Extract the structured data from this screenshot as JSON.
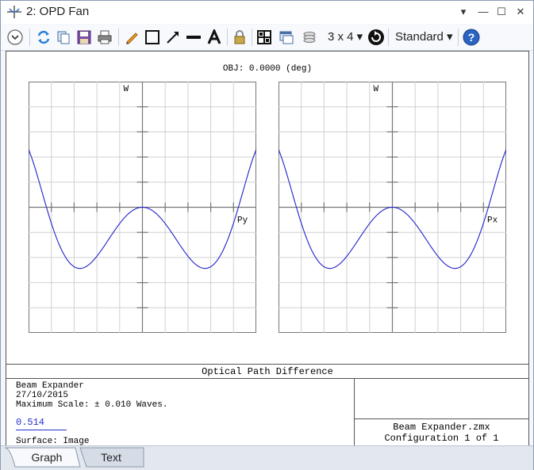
{
  "window": {
    "title": "2: OPD Fan",
    "controls": [
      "▾",
      "—",
      "☐",
      "✕"
    ]
  },
  "toolbar": {
    "layout_label": "3 x 4 ▾",
    "setting_label": "Standard ▾"
  },
  "plot": {
    "obj_label": "OBJ: 0.0000 (deg)",
    "left_axis_y": "W",
    "left_axis_x": "Py",
    "right_axis_y": "W",
    "right_axis_x": "Px",
    "curve_color": "#2222cc"
  },
  "chart_data": [
    {
      "type": "line",
      "xlabel": "Py",
      "ylabel": "W",
      "xlim": [
        -1,
        1
      ],
      "ylim": [
        -0.01,
        0.01
      ],
      "grid": true,
      "series": [
        {
          "x": [
            -1.0,
            -0.9,
            -0.8,
            -0.7,
            -0.6,
            -0.5,
            -0.4,
            -0.3,
            -0.2,
            -0.1,
            0.0,
            0.1,
            0.2,
            0.3,
            0.4,
            0.5,
            0.6,
            0.7,
            0.8,
            0.9,
            1.0
          ],
          "y": [
            0.0046,
            -0.0009,
            -0.0048,
            -0.0059,
            -0.0059,
            -0.0047,
            -0.0033,
            -0.0019,
            -0.0009,
            -0.0002,
            0.0,
            -0.0002,
            -0.0009,
            -0.0019,
            -0.0033,
            -0.0047,
            -0.0059,
            -0.0059,
            -0.0048,
            -0.0009,
            0.0046
          ]
        }
      ]
    },
    {
      "type": "line",
      "xlabel": "Px",
      "ylabel": "W",
      "xlim": [
        -1,
        1
      ],
      "ylim": [
        -0.01,
        0.01
      ],
      "grid": true,
      "series": [
        {
          "x": [
            -1.0,
            -0.9,
            -0.8,
            -0.7,
            -0.6,
            -0.5,
            -0.4,
            -0.3,
            -0.2,
            -0.1,
            0.0,
            0.1,
            0.2,
            0.3,
            0.4,
            0.5,
            0.6,
            0.7,
            0.8,
            0.9,
            1.0
          ],
          "y": [
            0.0046,
            -0.0009,
            -0.0048,
            -0.0059,
            -0.0059,
            -0.0047,
            -0.0033,
            -0.0019,
            -0.0009,
            -0.0002,
            0.0,
            -0.0002,
            -0.0009,
            -0.0019,
            -0.0033,
            -0.0047,
            -0.0059,
            -0.0059,
            -0.0048,
            -0.0009,
            0.0046
          ]
        }
      ]
    }
  ],
  "info": {
    "title": "Optical Path Difference",
    "lens_name": "Beam Expander",
    "date": "27/10/2015",
    "max_scale": "Maximum Scale: ± 0.010 Waves.",
    "scale_value": "0.514",
    "surface": "Surface: Image",
    "file": "Beam Expander.zmx",
    "config": "Configuration 1 of 1"
  },
  "tabs": [
    {
      "label": "Graph",
      "active": true
    },
    {
      "label": "Text",
      "active": false
    }
  ]
}
